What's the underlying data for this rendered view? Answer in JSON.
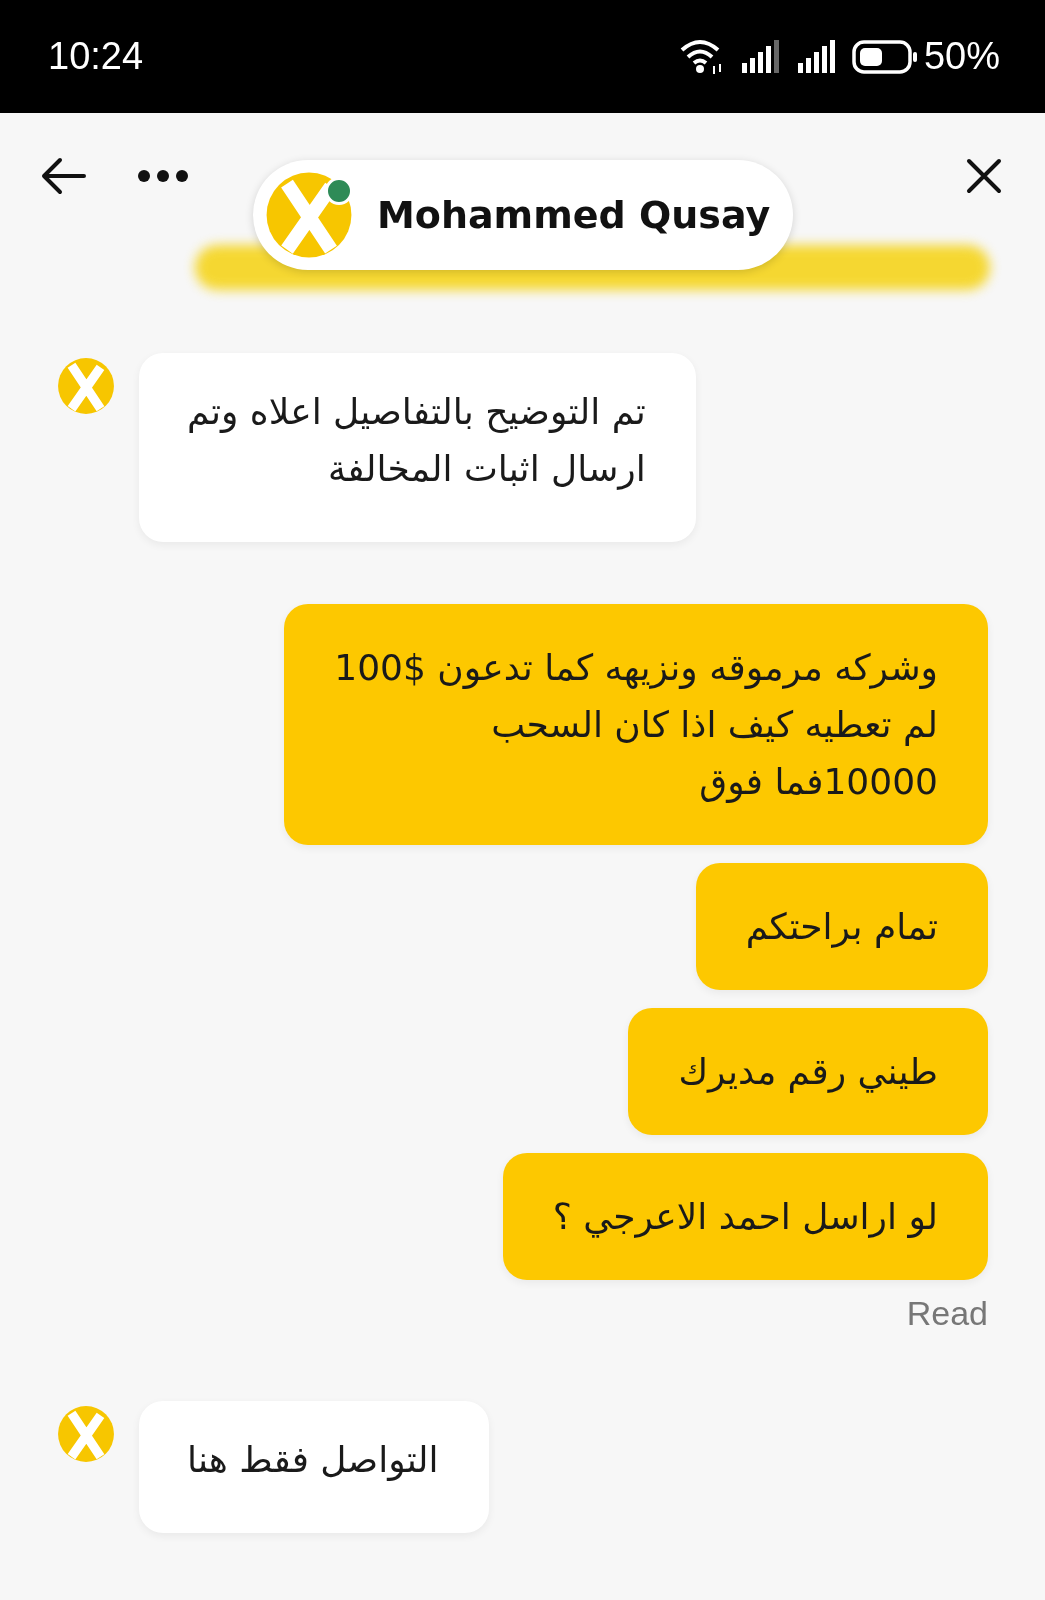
{
  "status_bar": {
    "time": "10:24",
    "battery": "50%"
  },
  "header": {
    "title": "Mohammed Qusay",
    "online": true
  },
  "messages": [
    {
      "kind": "incoming",
      "text": "تم التوضيح بالتفاصيل اعلاه وتم\nارسال اثبات المخالفة"
    },
    {
      "kind": "outgoing",
      "text": "وشركه مرموقه ونزيهه كما تدعون $100\nلم تعطيه كيف اذا كان السحب\n10000فما فوق"
    },
    {
      "kind": "outgoing",
      "text": "تمام براحتكم"
    },
    {
      "kind": "outgoing",
      "text": "طيني رقم مديرك"
    },
    {
      "kind": "outgoing",
      "text": "لو اراسل احمد الاعرجي ؟",
      "receipt": "Read"
    },
    {
      "kind": "incoming",
      "text": "التواصل فقط هنا"
    }
  ]
}
